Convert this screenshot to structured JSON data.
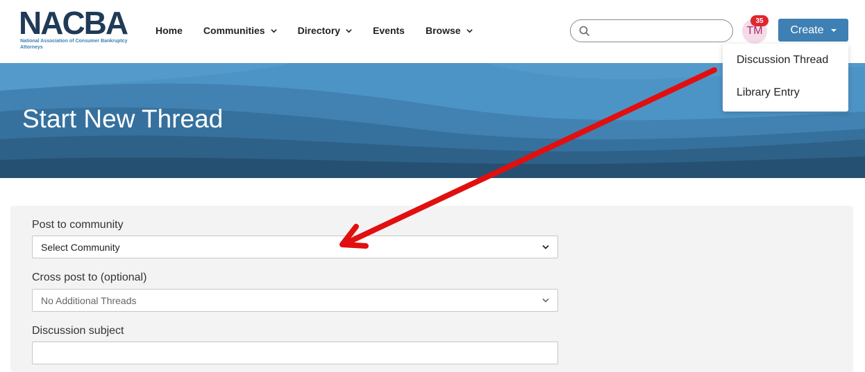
{
  "logo": {
    "word": "NACBA",
    "subtitle": "National Association of Consumer Bankruptcy Attorneys"
  },
  "nav": {
    "items": [
      {
        "label": "Home",
        "has_dropdown": false
      },
      {
        "label": "Communities",
        "has_dropdown": true
      },
      {
        "label": "Directory",
        "has_dropdown": true
      },
      {
        "label": "Events",
        "has_dropdown": false
      },
      {
        "label": "Browse",
        "has_dropdown": true
      }
    ]
  },
  "search": {
    "placeholder": "",
    "value": "",
    "icon": "search-icon"
  },
  "user": {
    "initials": "TM",
    "notification_count": "35"
  },
  "create_button": {
    "label": "Create"
  },
  "create_menu": {
    "items": [
      "Discussion Thread",
      "Library Entry"
    ]
  },
  "banner": {
    "title": "Start New Thread"
  },
  "form": {
    "community_label": "Post to community",
    "community_value": "Select Community",
    "crosspost_label": "Cross post to (optional)",
    "crosspost_value": "No Additional Threads",
    "subject_label": "Discussion subject",
    "subject_value": ""
  },
  "colors": {
    "brand_blue": "#3f80b4",
    "banner_blue": "#4d94c6",
    "badge_red": "#e0262d",
    "annotation_arrow": "#e10f0f"
  }
}
